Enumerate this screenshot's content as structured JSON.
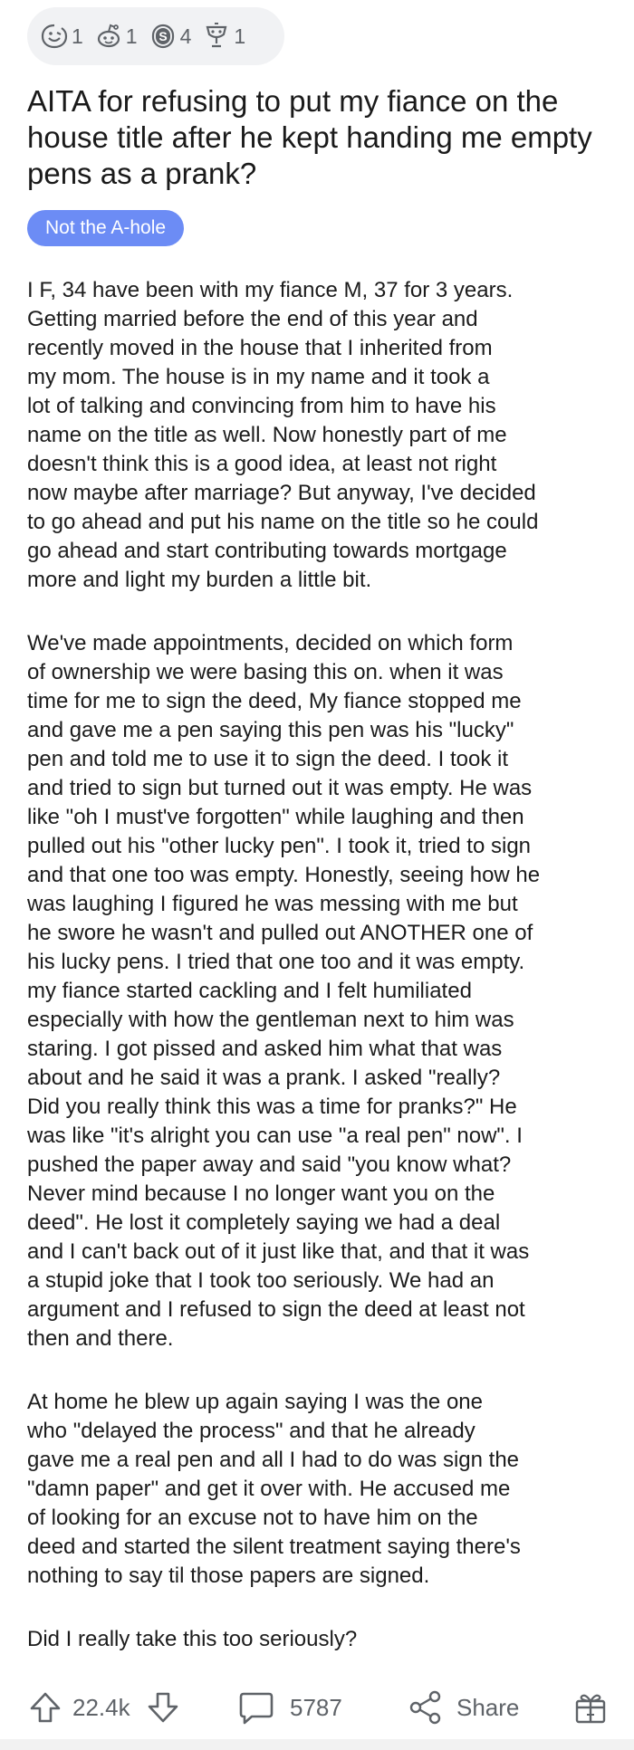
{
  "awards": [
    {
      "icon": "smiley-award-icon",
      "count": "1"
    },
    {
      "icon": "snoo-award-icon",
      "count": "1"
    },
    {
      "icon": "silver-coin-award-icon",
      "count": "4"
    },
    {
      "icon": "trophy-snoo-award-icon",
      "count": "1"
    }
  ],
  "post": {
    "title": "AITA for refusing to put my fiance on the house title after he kept handing me empty pens as a prank?",
    "flair": "Not the A-hole",
    "paragraphs": [
      "I F, 34 have been with my fiance M, 37 for 3 years.\nGetting married before the end of this year and\nrecently moved in the house that I inherited from\nmy mom. The house is in my name and it took a\nlot of talking and convincing from him to have his\nname on the title as well. Now honestly part of me\ndoesn't think this is a good idea, at least not right\nnow maybe after marriage? But anyway, I've decided\nto go ahead and put his name on the title so he could\ngo ahead and start contributing towards mortgage\nmore and light my burden a little bit.",
      "We've made appointments, decided on which form\nof ownership we were basing this on. when it was\ntime for me to sign the deed, My fiance stopped me\nand gave me a pen saying this pen was his \"lucky\"\npen and told me to use it to sign the deed. I took it\nand tried to sign but turned out it was empty. He was\nlike \"oh I must've forgotten\" while laughing and then\npulled out his \"other lucky pen\". I took it, tried to sign\nand that one too was empty. Honestly, seeing how he\nwas laughing I figured he was messing with me but\nhe swore he wasn't and pulled out ANOTHER one of\nhis lucky pens. I tried that one too and it was empty.\nmy fiance started cackling and I felt humiliated\nespecially with how the gentleman next to him was\nstaring. I got pissed and asked him what that was\nabout and he said it was a prank. I asked \"really?\nDid you really think this was a time for pranks?\" He\nwas like \"it's alright you can use \"a real pen\" now\". I\npushed the paper away and said \"you know what?\nNever mind because I no longer want you on the\ndeed\". He lost it completely saying we had a deal\nand I can't back out of it just like that, and that it was\na stupid joke that I took too seriously. We had an\nargument and I refused to sign the deed at least not\nthen and there.",
      "At home he blew up again saying I was the one\nwho \"delayed the process\" and that he already\ngave me a real pen and all I had to do was sign the\n\"damn paper\" and get it over with. He accused me\nof looking for an excuse not to have him on the\ndeed and started the silent treatment saying there's\nnothing to say til those papers are signed.",
      "Did I really take this too seriously?"
    ]
  },
  "actions": {
    "upvote_icon": "upvote-arrow-icon",
    "score": "22.4k",
    "downvote_icon": "downvote-arrow-icon",
    "comment_icon": "comment-bubble-icon",
    "comments": "5787",
    "share_icon": "share-icon",
    "share_label": "Share",
    "award_icon": "gift-award-icon"
  },
  "colors": {
    "flair_bg": "#6c8cf5",
    "awards_bg": "#f1f2f4",
    "meta_text": "#5f6368"
  }
}
